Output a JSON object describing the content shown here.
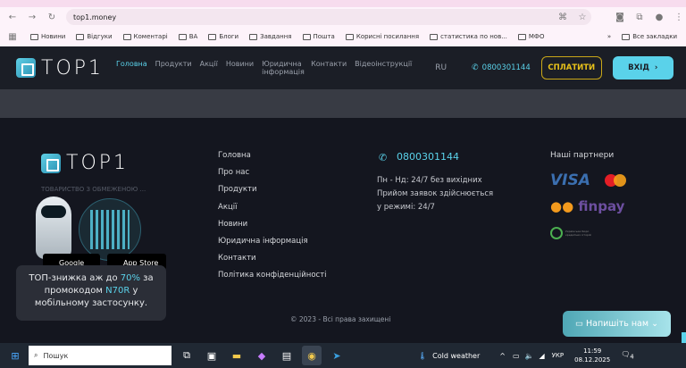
{
  "browser": {
    "url": "top1.money",
    "bookmarks": [
      "Новини",
      "Відгуки",
      "Коментарі",
      "ВА",
      "Блоги",
      "Завдання",
      "Пошта",
      "Корисні посилання",
      "статистика по нов...",
      "МФО"
    ],
    "all_bookmarks": "Все закладки"
  },
  "header": {
    "logo": "TOP1",
    "nav": [
      "Головна",
      "Продукти",
      "Акції",
      "Новини",
      "Юридична інформація",
      "Контакти",
      "Відеоінструкції"
    ],
    "lang": "RU",
    "phone": "0800301144",
    "pay_label": "СПЛАТИТИ",
    "login_label": "ВХІД"
  },
  "footer": {
    "company_text": "ТОВАРИСТВО З ОБМЕЖЕНОЮ ...",
    "links": [
      "Головна",
      "Про нас",
      "Продукти",
      "Акції",
      "Новини",
      "Юридична інформація",
      "Контакти",
      "Політика конфіденційності"
    ],
    "phone": "0800301144",
    "hours": [
      "Пн - Нд: 24/7 без вихідних",
      "Прийом заявок здійснюється",
      "у режимі: 24/7"
    ],
    "partners_title": "Наші партнери",
    "partners": [
      "VISA",
      "MasterCard",
      "finpay",
      "Українське бюро кредитних історій"
    ],
    "copyright": "© 2023 - Всі права захищені",
    "google_play": "Google Play",
    "app_store": "App Store"
  },
  "promo": {
    "pre": "ТОП-знижка аж до ",
    "pct": "70%",
    "mid": " за промокодом ",
    "code": "N70R",
    "post": " у мобільному застосунку."
  },
  "chat": {
    "label": "Напишіть нам"
  },
  "taskbar": {
    "search": "Пошук",
    "weather": "Cold weather",
    "lang": "УКР",
    "time": "11:59",
    "date": "08.12.2025",
    "notif": "4"
  },
  "colors": {
    "accent": "#5ad2ea",
    "pay": "#e8c21a"
  }
}
